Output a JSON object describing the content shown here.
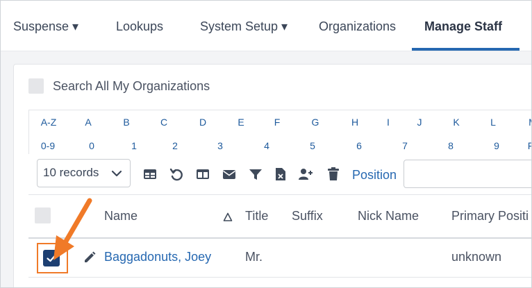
{
  "nav": {
    "items": [
      {
        "label": "Suspense ▾"
      },
      {
        "label": "Lookups"
      },
      {
        "label": "System Setup ▾"
      },
      {
        "label": "Organizations"
      },
      {
        "label": "Manage Staff"
      }
    ],
    "active_index": 4
  },
  "search_all": {
    "label": "Search All My Organizations",
    "checked": false
  },
  "alphabet": {
    "row1": [
      "A-Z",
      "A",
      "B",
      "C",
      "D",
      "E",
      "F",
      "G",
      "H",
      "I",
      "J",
      "K",
      "L",
      "M"
    ],
    "row2": [
      "0-9",
      "0",
      "1",
      "2",
      "3",
      "4",
      "5",
      "6",
      "7",
      "8",
      "9",
      "F"
    ]
  },
  "toolbar": {
    "records_select": "10 records",
    "icons": [
      "table-view-icon",
      "reset-icon",
      "columns-icon",
      "email-icon",
      "filter-icon",
      "export-excel-icon",
      "add-user-icon",
      "delete-icon"
    ],
    "position_label": "Position",
    "position_value": ""
  },
  "table": {
    "columns": [
      "Name",
      "Title",
      "Suffix",
      "Nick Name",
      "Primary Positi"
    ],
    "rows": [
      {
        "checked": true,
        "name": "Baggadonuts, Joey",
        "title": "Mr.",
        "suffix": "",
        "nick_name": "",
        "primary_position": "unknown"
      }
    ]
  },
  "colors": {
    "accent": "#2668b1",
    "checkbox_checked": "#1d3f72",
    "annotation": "#f07a28"
  }
}
